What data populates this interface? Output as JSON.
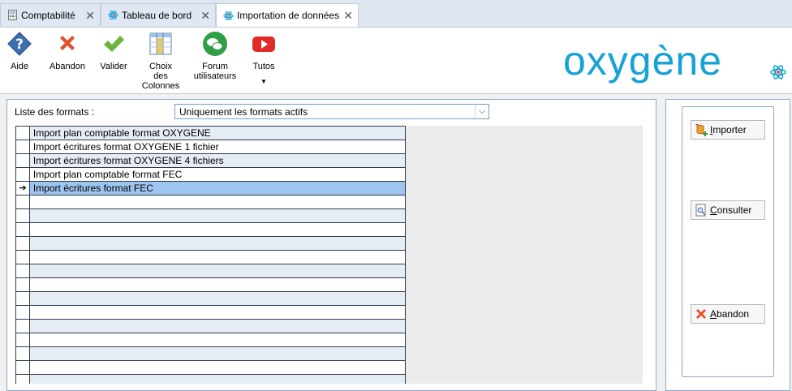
{
  "tabs": [
    {
      "label": "Comptabilité",
      "icon": "calculator-icon",
      "active": false
    },
    {
      "label": "Tableau de bord",
      "icon": "atom-icon",
      "active": false
    },
    {
      "label": "Importation de données",
      "icon": "atom-icon",
      "active": true
    }
  ],
  "toolbar": {
    "aide": "Aide",
    "abandon": "Abandon",
    "valider": "Valider",
    "choix_line1": "Choix",
    "choix_line2": "des",
    "choix_line3": "Colonnes",
    "forum_line1": "Forum",
    "forum_line2": "utilisateurs",
    "tutos": "Tutos"
  },
  "brand": {
    "name": "oxygène",
    "color": "#17a2d6"
  },
  "filter": {
    "label": "Liste des formats :",
    "selected": "Uniquement les formats actifs"
  },
  "formats": [
    "Import plan comptable format OXYGENE",
    "Import écritures format OXYGENE 1 fichier",
    "Import écritures format OXYGENE 4 fichiers",
    "Import plan comptable format FEC",
    "Import écritures format FEC"
  ],
  "selected_row_index": 4,
  "actions": {
    "importer_first": "I",
    "importer_rest": "mporter",
    "consulter_first": "C",
    "consulter_rest": "onsulter",
    "abandon_first": "A",
    "abandon_rest": "bandon"
  },
  "colors": {
    "accent": "#17a2d6",
    "selection": "#9ec5f0",
    "row_alt": "#e6ecf4"
  }
}
